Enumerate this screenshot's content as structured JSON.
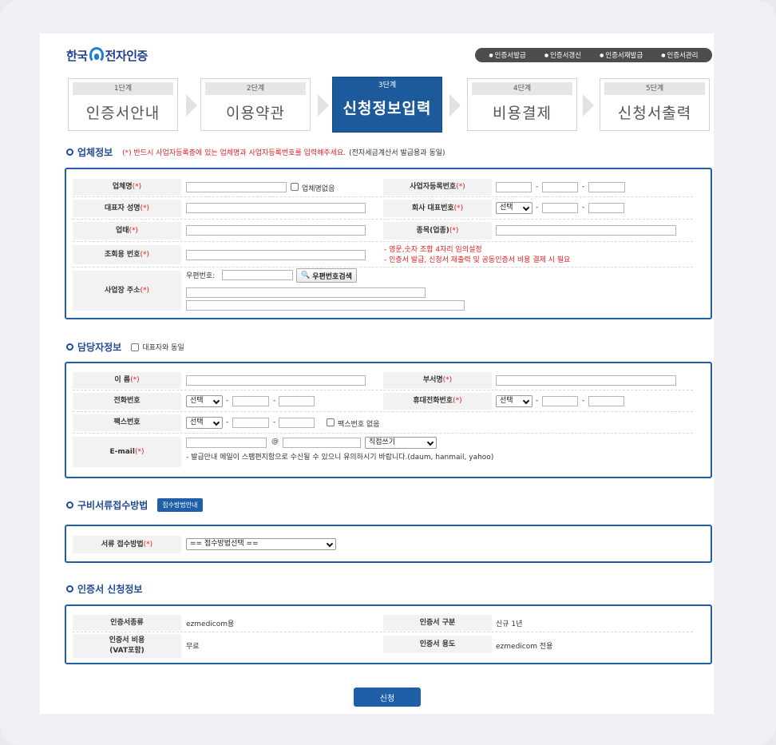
{
  "header": {
    "logo_left": "한국",
    "logo_right": "전자인증",
    "menu": [
      "인증서발급",
      "인증서갱신",
      "인증서재발급",
      "인증서관리"
    ]
  },
  "steps": [
    {
      "num": "1단계",
      "label": "인증서안내"
    },
    {
      "num": "2단계",
      "label": "이용약관"
    },
    {
      "num": "3단계",
      "label": "신청정보입력"
    },
    {
      "num": "4단계",
      "label": "비용결제"
    },
    {
      "num": "5단계",
      "label": "신청서출력"
    }
  ],
  "required_mark": "(*)",
  "company": {
    "title": "업체정보",
    "note_red": "(*) 반드시 사업자등록증에 있는 업체명과 사업자등록번호를 입력해주세요.",
    "note_gray": "(전자세금계산서 발급용과 동일)",
    "name_label": "업체명",
    "no_name_label": "업체명없음",
    "bizno_label": "사업자등록번호",
    "ceo_label": "대표자 성명",
    "phone_label": "회사 대표번호",
    "phone_select": "선택",
    "biztype_label": "업태",
    "bizitem_label": "종목(업종)",
    "lookup_label": "조회용 번호",
    "lookup_note1": "- 영문,숫자 조합 4자리 임의설정",
    "lookup_note2": "- 인증서 발급, 신청서 재출력 및 공동인증서 비용 결제 시 필요",
    "addr_label": "사업장 주소",
    "zip_label": "우편번호:",
    "zip_search": "우편번호검색"
  },
  "contact": {
    "title": "담당자정보",
    "same_as_ceo": "대표자와 동일",
    "name_label": "이 름",
    "dept_label": "부서명",
    "tel_label": "전화번호",
    "mobile_label": "휴대전화번호",
    "fax_label": "팩스번호",
    "no_fax": "팩스번호 없음",
    "select": "선택",
    "email_label": "E-mail",
    "at": "@",
    "email_select": "직접쓰기",
    "email_note": "- 발급안내 메일이 스팸편지함으로 수신될 수 있으니 유의하시기 바랍니다.(daum, hanmail, yahoo)"
  },
  "docs": {
    "title": "구비서류접수방법",
    "guide_button": "접수방법안내",
    "method_label": "서류 접수방법",
    "method_select": "== 접수방법선택 =="
  },
  "cert": {
    "title": "인증서 신청정보",
    "type_label": "인증서종류",
    "type_value": "ezmedicom용",
    "kind_label": "인증서 구분",
    "kind_value": "신규 1년",
    "cost_label1": "인증서 비용",
    "cost_label2": "(VAT포함)",
    "cost_value": "무료",
    "usage_label": "인증서 용도",
    "usage_value": "ezmedicom 전용"
  },
  "submit_label": "신청",
  "colors": {
    "accent": "#1f5ea8",
    "required": "#e02020",
    "active_step": "#1c5a9c"
  }
}
